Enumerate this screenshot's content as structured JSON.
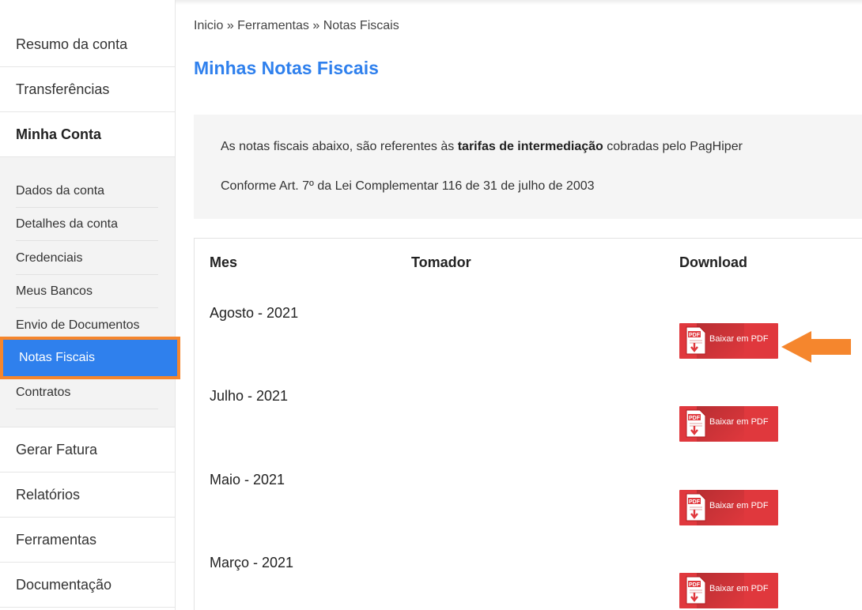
{
  "sidebar": {
    "top_items": [
      {
        "label": "Resumo da conta"
      },
      {
        "label": "Transferências"
      },
      {
        "label": "Minha Conta"
      }
    ],
    "sub_items": [
      {
        "label": "Dados da conta"
      },
      {
        "label": "Detalhes da conta"
      },
      {
        "label": "Credenciais"
      },
      {
        "label": "Meus Bancos"
      },
      {
        "label": "Envio de Documentos"
      },
      {
        "label": "Notas Fiscais"
      },
      {
        "label": "Contratos"
      }
    ],
    "bottom_items": [
      {
        "label": "Gerar Fatura"
      },
      {
        "label": "Relatórios"
      },
      {
        "label": "Ferramentas"
      },
      {
        "label": "Documentação"
      }
    ]
  },
  "breadcrumb": {
    "home": "Inicio",
    "sep": "»",
    "tools": "Ferramentas",
    "current": "Notas Fiscais"
  },
  "page_title": "Minhas Notas Fiscais",
  "info": {
    "line1_pre": "As notas fiscais abaixo, são referentes às",
    "line1_bold": "tarifas de intermediação",
    "line1_post": "cobradas pelo PagHiper",
    "line2": "Conforme Art. 7º da Lei Complementar 116 de 31 de julho de 2003"
  },
  "table": {
    "headers": {
      "month": "Mes",
      "taker": "Tomador",
      "download": "Download"
    },
    "rows": [
      {
        "month": "Agosto - 2021",
        "button": "Baixar em PDF",
        "icon_label": "PDF"
      },
      {
        "month": "Julho - 2021",
        "button": "Baixar em PDF",
        "icon_label": "PDF"
      },
      {
        "month": "Maio - 2021",
        "button": "Baixar em PDF",
        "icon_label": "PDF"
      },
      {
        "month": "Março - 2021",
        "button": "Baixar em PDF",
        "icon_label": "PDF"
      }
    ]
  },
  "colors": {
    "accent": "#2f80ed",
    "highlight": "#f5862d",
    "pdf_button": "#e0383d"
  }
}
